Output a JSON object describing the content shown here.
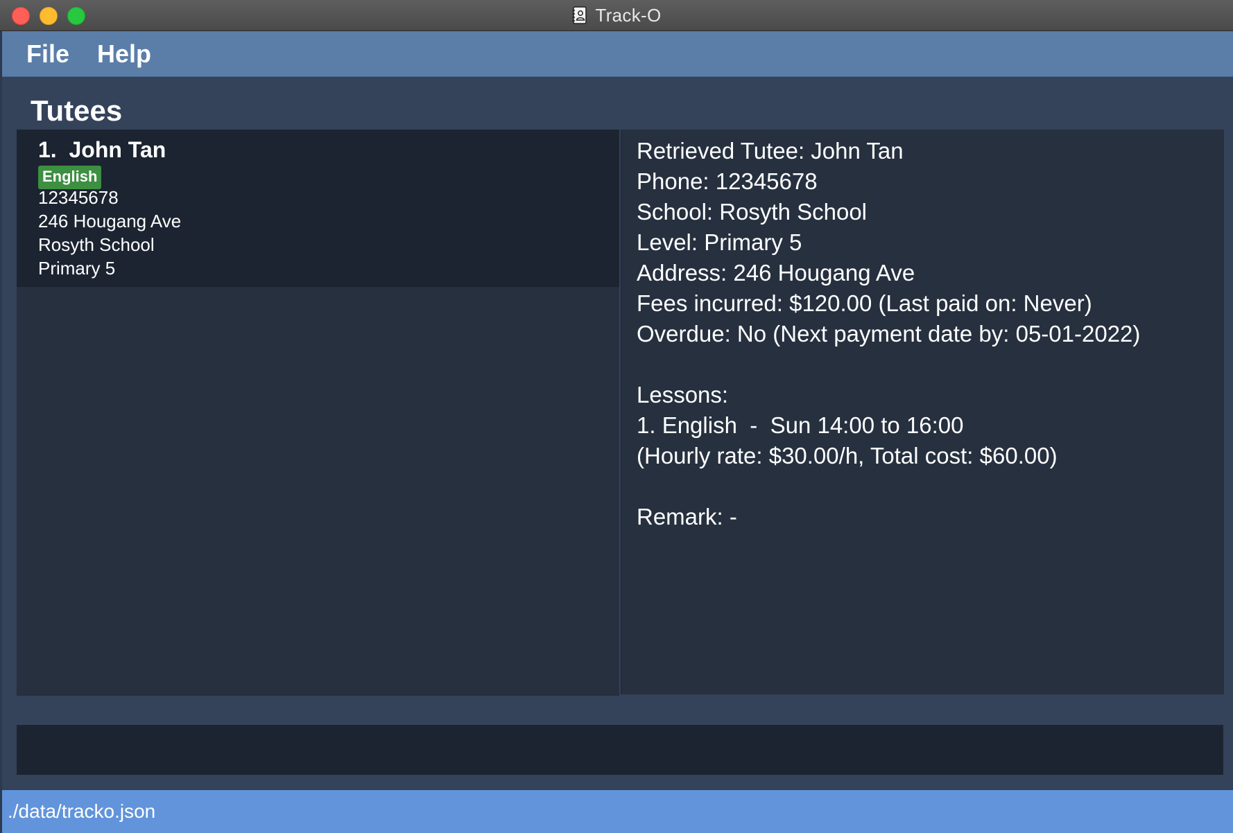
{
  "window": {
    "title": "Track-O"
  },
  "menu": {
    "file": "File",
    "help": "Help"
  },
  "tutees": {
    "heading": "Tutees",
    "items": [
      {
        "index_name": "1.  John Tan",
        "tag": "English",
        "phone": "12345678",
        "address": "246 Hougang Ave",
        "school": "Rosyth School",
        "level": "Primary 5"
      }
    ]
  },
  "detail": {
    "lines": [
      "Retrieved Tutee: John Tan",
      "Phone: 12345678",
      "School: Rosyth School",
      "Level: Primary 5",
      "Address: 246 Hougang Ave",
      "Fees incurred: $120.00 (Last paid on: Never)",
      "Overdue: No (Next payment date by: 05-01-2022)",
      "Lessons:",
      "1. English  -  Sun 14:00 to 16:00",
      "(Hourly rate: $30.00/h, Total cost: $60.00)",
      "Remark: -"
    ]
  },
  "status": {
    "path": "./data/tracko.json"
  },
  "colors": {
    "menubar": "#5a7ea8",
    "statusbar": "#6194db",
    "tag": "#3d8f41",
    "panel": "#26303f",
    "card": "#1c2431"
  }
}
